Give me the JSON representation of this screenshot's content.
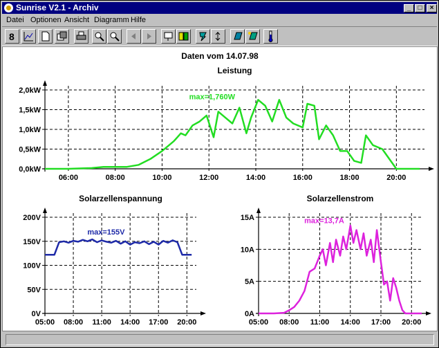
{
  "window": {
    "title": "Sunrise V2.1 - Archiv",
    "controls": [
      "_",
      "□",
      "×"
    ]
  },
  "menu": [
    "Datei",
    "Optionen",
    "Ansicht",
    "Diagramm",
    "Hilfe"
  ],
  "toolbar": [
    "info-icon",
    "chart-icon",
    "new-icon",
    "windows-icon",
    "print-icon",
    "zoom-in-icon",
    "zoom-out-icon",
    "back-icon",
    "forward-icon",
    "panel-icon",
    "panels-icon",
    "voltage-icon",
    "current-icon",
    "solar-panel-icon",
    "solar-panel-alt-icon",
    "thermometer-icon"
  ],
  "header": {
    "date_label": "Daten vom 14.07.98"
  },
  "colors": {
    "power": "#22dd22",
    "voltage": "#1e2aa8",
    "current": "#dd22dd"
  },
  "chart_data": [
    {
      "type": "line",
      "title": "Leistung",
      "annotation": "max=1,760W",
      "xlim": [
        5,
        21.2
      ],
      "ylim": [
        0,
        2.0
      ],
      "xticks": [
        "06:00",
        "08:00",
        "10:00",
        "12:00",
        "14:00",
        "16:00",
        "18:00",
        "20:00"
      ],
      "xtick_values": [
        6,
        8,
        10,
        12,
        14,
        16,
        18,
        20
      ],
      "yticks": [
        "0,0kW",
        "0,5kW",
        "1,0kW",
        "1,5kW",
        "2,0kW"
      ],
      "ytick_values": [
        0,
        0.5,
        1.0,
        1.5,
        2.0
      ],
      "grid": true,
      "series": [
        {
          "x": [
            5,
            6,
            7,
            7.5,
            8.5,
            9,
            9.5,
            10,
            10.3,
            10.5,
            10.8,
            11,
            11.3,
            11.6,
            11.9,
            12.2,
            12.4,
            12.7,
            13,
            13.3,
            13.6,
            13.8,
            14.1,
            14.4,
            14.7,
            15,
            15.3,
            15.6,
            16,
            16.2,
            16.5,
            16.7,
            17,
            17.3,
            17.6,
            17.9,
            18.2,
            18.5,
            18.7,
            19,
            19.4,
            20,
            21
          ],
          "y": [
            0,
            0,
            0.02,
            0.05,
            0.05,
            0.1,
            0.25,
            0.45,
            0.6,
            0.7,
            0.9,
            0.85,
            1.1,
            1.2,
            1.35,
            0.8,
            1.45,
            1.3,
            1.15,
            1.55,
            0.9,
            1.3,
            1.75,
            1.6,
            1.2,
            1.75,
            1.3,
            1.15,
            1.05,
            1.65,
            1.6,
            0.75,
            1.1,
            0.85,
            0.45,
            0.45,
            0.2,
            0.15,
            0.85,
            0.6,
            0.5,
            0,
            0
          ]
        }
      ]
    },
    {
      "type": "line",
      "title": "Solarzellenspannung",
      "annotation": "max=155V",
      "xlim": [
        5,
        21
      ],
      "ylim": [
        0,
        200
      ],
      "xticks": [
        "05:00",
        "08:00",
        "11:00",
        "14:00",
        "17:00",
        "20:00"
      ],
      "xtick_values": [
        5,
        8,
        11,
        14,
        17,
        20
      ],
      "yticks": [
        "0V",
        "50V",
        "100V",
        "150V",
        "200V"
      ],
      "ytick_values": [
        0,
        50,
        100,
        150,
        200
      ],
      "grid": true,
      "series": [
        {
          "x": [
            5,
            6,
            6.5,
            7,
            7.5,
            8,
            8.5,
            9,
            9.5,
            10,
            10.5,
            11,
            11.5,
            12,
            12.5,
            13,
            13.5,
            14,
            14.5,
            15,
            15.5,
            16,
            16.5,
            17,
            17.5,
            18,
            18.5,
            19,
            19.5,
            20,
            20.5
          ],
          "y": [
            122,
            122,
            148,
            150,
            147,
            151,
            149,
            153,
            150,
            154,
            148,
            152,
            149,
            147,
            151,
            145,
            150,
            143,
            148,
            146,
            150,
            144,
            149,
            143,
            151,
            147,
            152,
            148,
            122,
            122,
            122
          ]
        }
      ]
    },
    {
      "type": "line",
      "title": "Solarzellenstrom",
      "annotation": "max=13,7A",
      "xlim": [
        5,
        21
      ],
      "ylim": [
        0,
        15
      ],
      "xticks": [
        "05:00",
        "08:00",
        "11:00",
        "14:00",
        "17:00",
        "20:00"
      ],
      "xtick_values": [
        5,
        8,
        11,
        14,
        17,
        20
      ],
      "yticks": [
        "0A",
        "5A",
        "10A",
        "15A"
      ],
      "ytick_values": [
        0,
        5,
        10,
        15
      ],
      "grid": true,
      "series": [
        {
          "x": [
            5,
            6.5,
            7.5,
            8,
            8.5,
            9,
            9.5,
            10,
            10.5,
            11,
            11.3,
            11.6,
            12,
            12.3,
            12.6,
            13,
            13.3,
            13.6,
            14,
            14.3,
            14.6,
            15,
            15.3,
            15.6,
            16,
            16.3,
            16.6,
            17,
            17.3,
            17.6,
            17.9,
            18.2,
            18.5,
            18.8,
            19.1,
            19.4,
            20,
            21
          ],
          "y": [
            0,
            0,
            0.1,
            0.5,
            1,
            2,
            3.5,
            6.5,
            7,
            9,
            10,
            7.5,
            11,
            8,
            11.5,
            9,
            12,
            10,
            13.7,
            11,
            13,
            10,
            12.5,
            9,
            11.5,
            8,
            13,
            8,
            4.5,
            5,
            2,
            5.5,
            4,
            2,
            0.5,
            0,
            0,
            0
          ]
        }
      ]
    }
  ]
}
